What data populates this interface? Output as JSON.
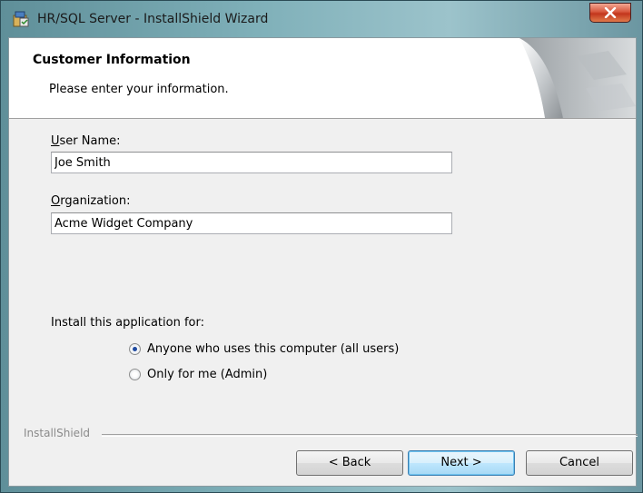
{
  "window": {
    "title": "HR/SQL Server - InstallShield Wizard",
    "close_symbol": "X"
  },
  "banner": {
    "title": "Customer Information",
    "subtitle": "Please enter your information."
  },
  "form": {
    "user_name_label_mnemonic": "U",
    "user_name_label_rest": "ser Name:",
    "user_name_value": "Joe Smith",
    "organization_label_mnemonic": "O",
    "organization_label_rest": "rganization:",
    "organization_value": "Acme Widget Company",
    "install_for_label": "Install this application for:",
    "options": [
      {
        "label": "Anyone who uses this computer (all users)",
        "selected": true
      },
      {
        "label": "Only for me (Admin)",
        "selected": false
      }
    ]
  },
  "footer": {
    "brand": "InstallShield",
    "back_label": "< Back",
    "next_label": "Next >",
    "cancel_label": "Cancel"
  },
  "colors": {
    "title_glass": "#7fb0b9",
    "dialog_bg": "#f0f0f0",
    "default_button_border": "#3c7fb1",
    "radio_dot": "#1f4aa0"
  }
}
